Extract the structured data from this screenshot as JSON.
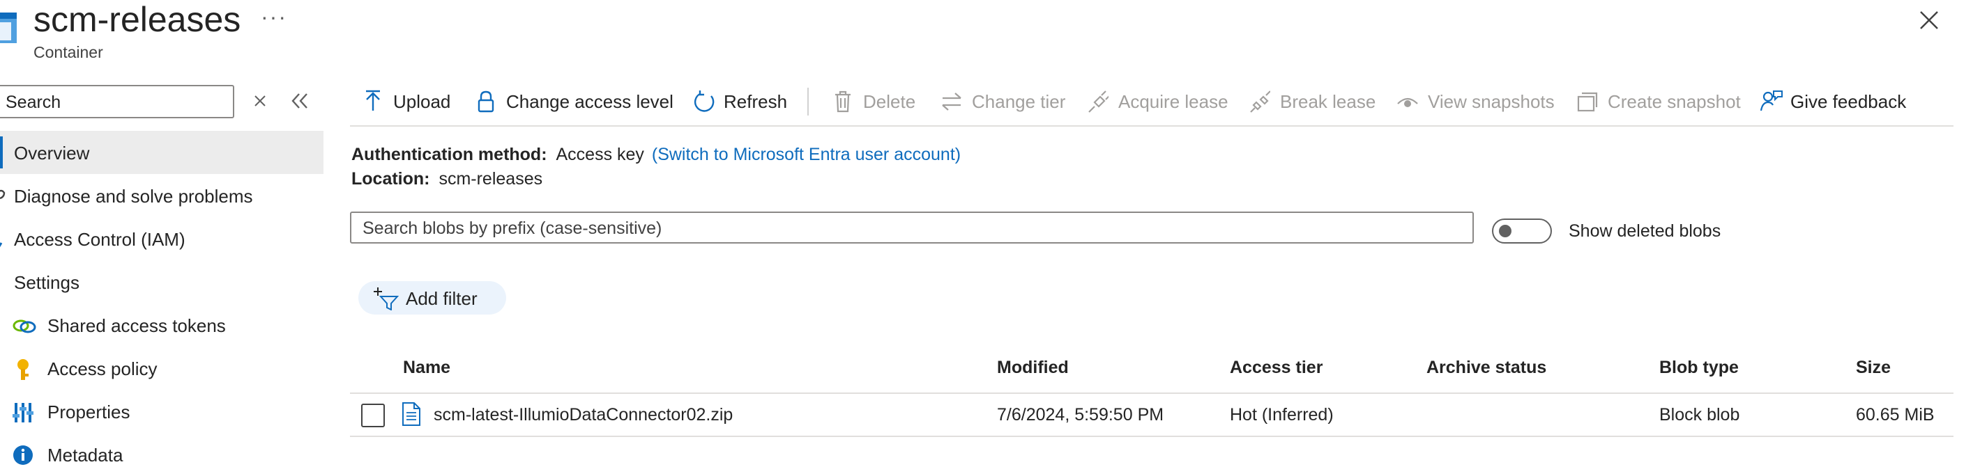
{
  "header": {
    "title": "scm-releases",
    "more": "···",
    "subtitle": "Container"
  },
  "sidebar": {
    "search_placeholder": "Search",
    "items": [
      {
        "label": "Overview",
        "icon": "overview-icon",
        "selected": true
      },
      {
        "label": "Diagnose and solve problems",
        "icon": "wrench-icon"
      },
      {
        "label": "Access Control (IAM)",
        "icon": "people-icon"
      },
      {
        "label": "Settings",
        "icon": "none"
      },
      {
        "label": "Shared access tokens",
        "icon": "link-icon"
      },
      {
        "label": "Access policy",
        "icon": "key-icon"
      },
      {
        "label": "Properties",
        "icon": "properties-icon"
      },
      {
        "label": "Metadata",
        "icon": "info-icon"
      }
    ]
  },
  "toolbar": {
    "upload": "Upload",
    "change_access_level": "Change access level",
    "refresh": "Refresh",
    "delete": "Delete",
    "change_tier": "Change tier",
    "acquire_lease": "Acquire lease",
    "break_lease": "Break lease",
    "view_snapshots": "View snapshots",
    "create_snapshot": "Create snapshot",
    "give_feedback": "Give feedback"
  },
  "info": {
    "auth_label": "Authentication method:",
    "auth_value": "Access key",
    "auth_link": "(Switch to Microsoft Entra user account)",
    "location_label": "Location:",
    "location_value": "scm-releases"
  },
  "blob_search": {
    "placeholder": "Search blobs by prefix (case-sensitive)"
  },
  "show_deleted": {
    "label": "Show deleted blobs",
    "on": false
  },
  "filter": {
    "label": "Add filter"
  },
  "table": {
    "headers": {
      "name": "Name",
      "modified": "Modified",
      "tier": "Access tier",
      "archive": "Archive status",
      "type": "Blob type",
      "size": "Size"
    },
    "rows": [
      {
        "name": "scm-latest-IllumioDataConnector02.zip",
        "modified": "7/6/2024, 5:59:50 PM",
        "tier": "Hot (Inferred)",
        "archive": "",
        "type": "Block blob",
        "size": "60.65 MiB"
      }
    ]
  },
  "colors": {
    "accent": "#0f6cbd",
    "disabled": "#a19f9d",
    "selected_bg": "#ececec"
  }
}
